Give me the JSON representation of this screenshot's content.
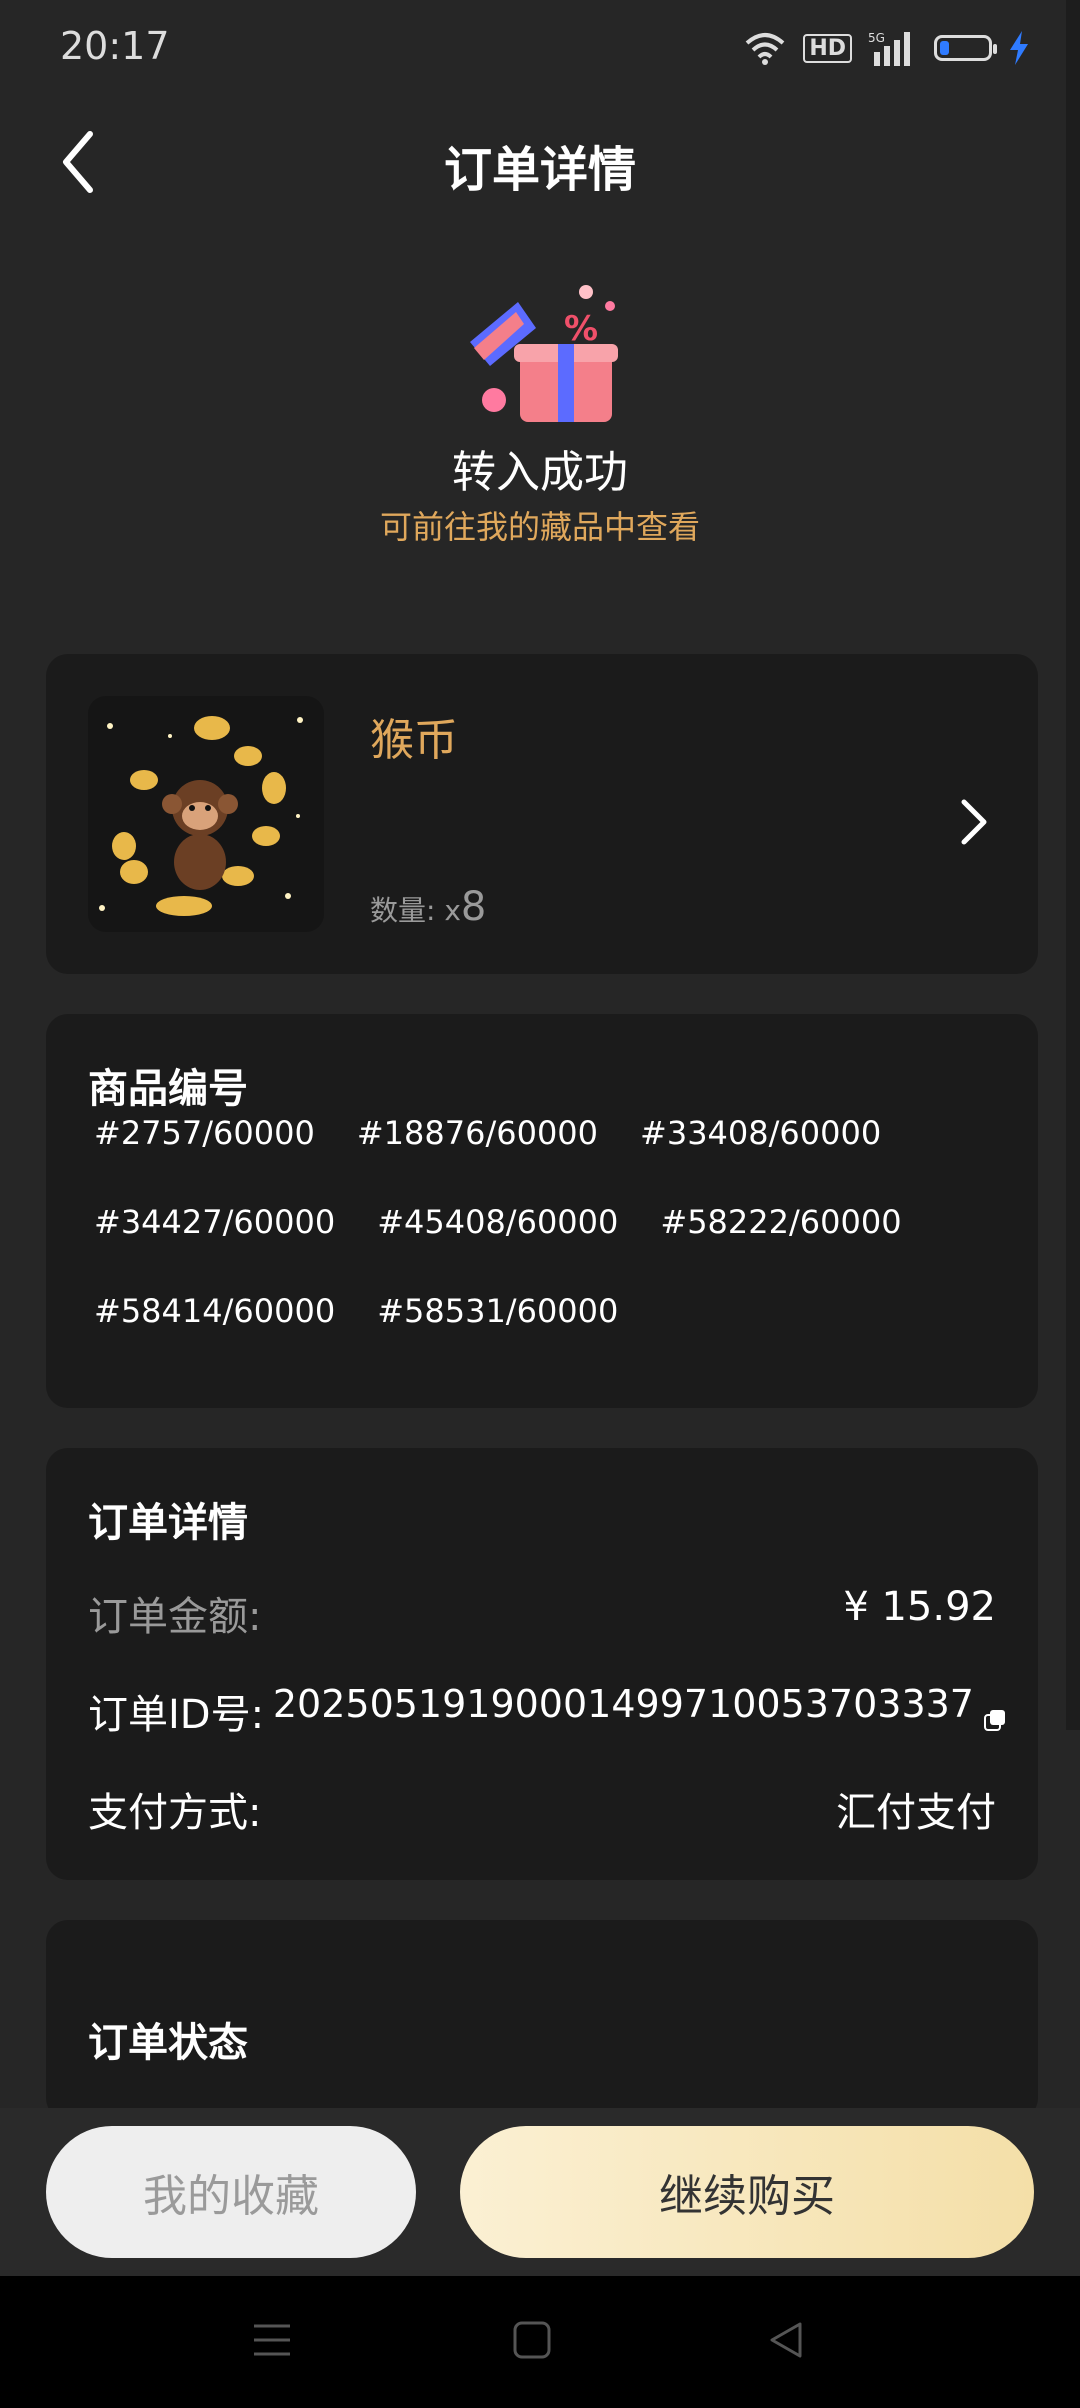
{
  "status_bar": {
    "time": "20:17",
    "hd": "HD",
    "network": "5G",
    "icons": [
      "wifi-icon",
      "hd-icon",
      "signal-5g-icon",
      "battery-icon",
      "charging-icon"
    ],
    "battery_level": 0.2
  },
  "header": {
    "title": "订单详情",
    "back_icon": "chevron-left-icon"
  },
  "success": {
    "title": "转入成功",
    "subtitle": "可前往我的藏品中查看"
  },
  "product": {
    "name": "猴币",
    "quantity_label": "数量:",
    "quantity_prefix": "x",
    "quantity": "8"
  },
  "serials": {
    "title": "商品编号",
    "rows": [
      [
        "#2757/60000",
        "#18876/60000",
        "#33408/60000"
      ],
      [
        "#34427/60000",
        "#45408/60000",
        "#58222/60000"
      ],
      [
        "#58414/60000",
        "#58531/60000"
      ]
    ]
  },
  "order": {
    "title": "订单详情",
    "amount_label": "订单金额:",
    "amount_value": "¥ 15.92",
    "id_label": "订单ID号:",
    "id_value": "20250519190001499710053703337",
    "pay_label": "支付方式:",
    "pay_value": "汇付支付"
  },
  "order_status": {
    "title": "订单状态"
  },
  "buttons": {
    "collection": "我的收藏",
    "continue": "继续购买"
  },
  "colors": {
    "background": "#262626",
    "card": "#1b1b1b",
    "accent_gold": "#e0a85c",
    "buy_button": "#f4dfa8"
  }
}
